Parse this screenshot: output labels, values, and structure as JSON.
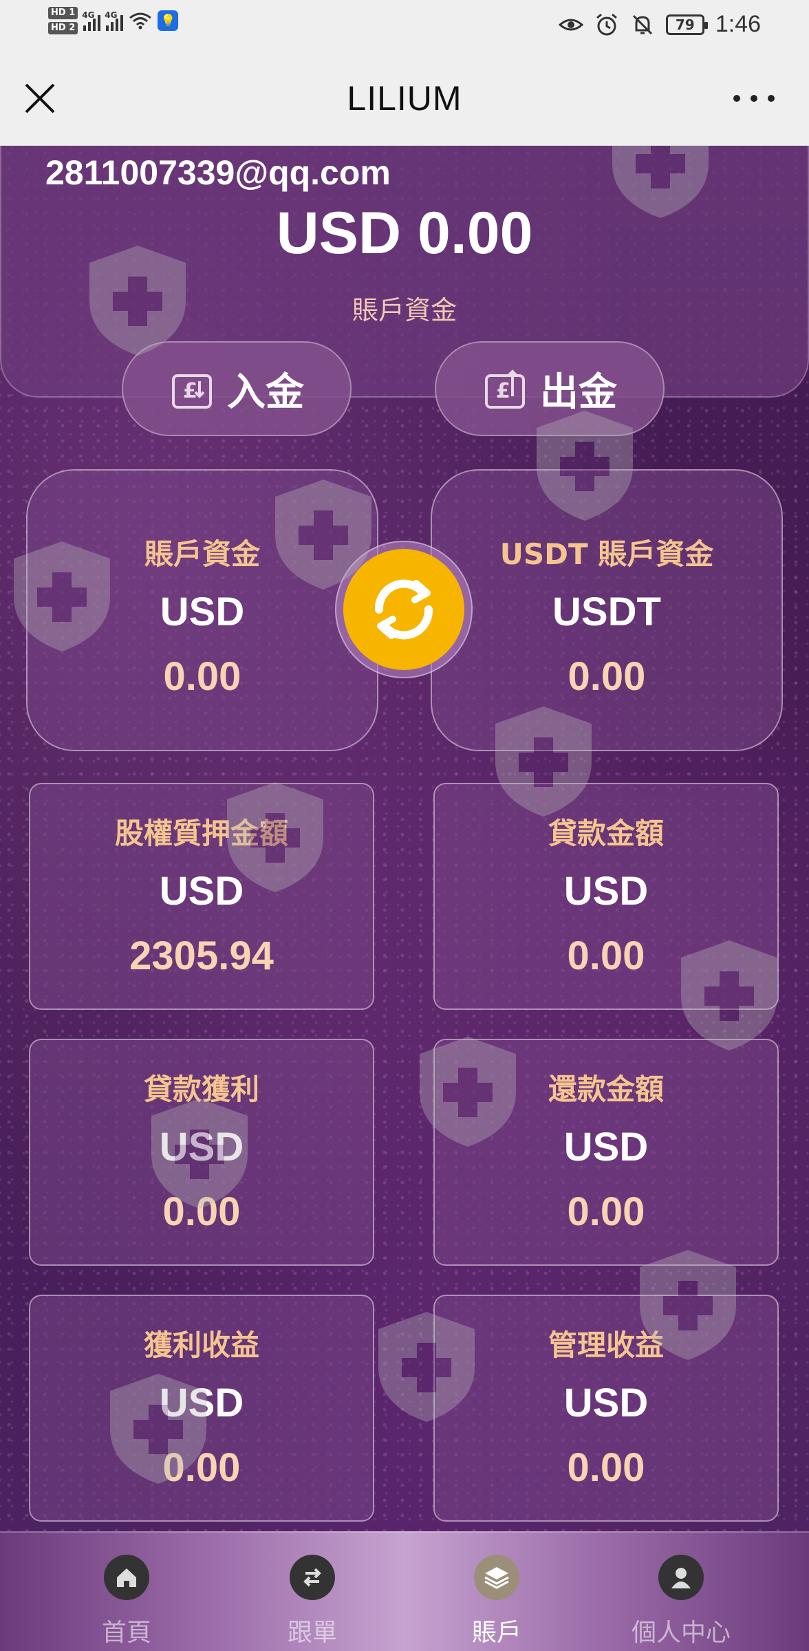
{
  "status_bar": {
    "sim1": "HD 1",
    "sim2": "HD 2",
    "signal1_label": "4G",
    "signal2_label": "4G",
    "battery": "79",
    "time": "1:46"
  },
  "title_bar": {
    "title": "LILIUM"
  },
  "account": {
    "email": "2811007339@qq.com",
    "balance": "USD 0.00",
    "balance_label": "賬戶資金",
    "deposit_label": "入金",
    "withdraw_label": "出金"
  },
  "summary_cards": [
    {
      "label": "賬戶資金",
      "currency": "USD",
      "value": "0.00"
    },
    {
      "label": "USDT 賬戶資金",
      "currency": "USDT",
      "value": "0.00"
    }
  ],
  "detail_cards": [
    {
      "label": "股權質押金額",
      "currency": "USD",
      "value": "2305.94"
    },
    {
      "label": "貸款金額",
      "currency": "USD",
      "value": "0.00"
    },
    {
      "label": "貸款獲利",
      "currency": "USD",
      "value": "0.00"
    },
    {
      "label": "還款金額",
      "currency": "USD",
      "value": "0.00"
    },
    {
      "label": "獲利收益",
      "currency": "USD",
      "value": "0.00"
    },
    {
      "label": "管理收益",
      "currency": "USD",
      "value": "0.00"
    }
  ],
  "bottom_nav": [
    {
      "label": "首頁",
      "icon": "home-icon",
      "active": false
    },
    {
      "label": "跟單",
      "icon": "exchange-icon",
      "active": false
    },
    {
      "label": "賬戶",
      "icon": "layers-icon",
      "active": true
    },
    {
      "label": "個人中心",
      "icon": "user-icon",
      "active": false
    }
  ],
  "colors": {
    "label_gold": "#f5c58f",
    "value_peach": "#f9d3b2",
    "swap_yellow": "#f7b500",
    "background_purple": "#3a1648"
  }
}
